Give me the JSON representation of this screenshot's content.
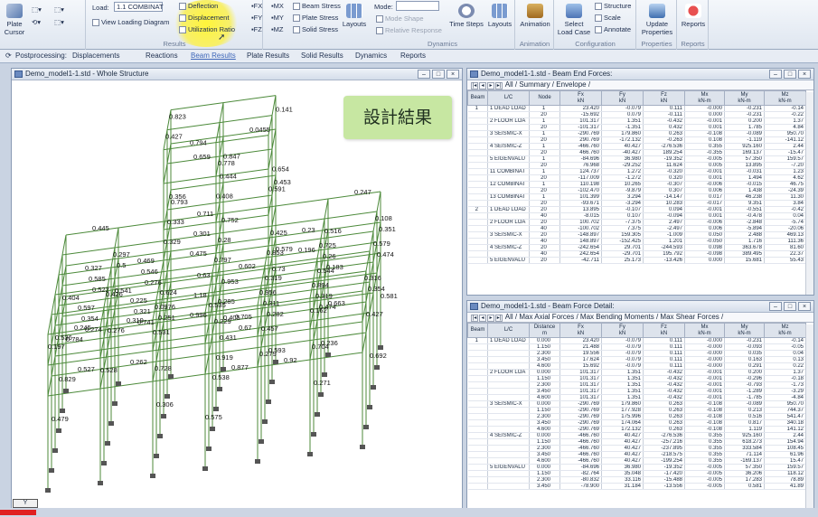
{
  "ribbon": {
    "plate_label": "Plate",
    "cursor_label": "Cursor",
    "load_label": "Load:",
    "load_value": "1.1 COMBINAT",
    "view_loading_diagram": "View Loading Diagram",
    "deflection": "Deflection",
    "displacement": "Displacement",
    "utilization_ratio": "Utilization Ratio",
    "results_group": "Results",
    "force_fx": "FX",
    "force_fy": "FY",
    "force_fz": "FZ",
    "moment_mx": "MX",
    "moment_my": "MY",
    "moment_mz": "MZ",
    "beam_stress": "Beam Stress",
    "plate_stress": "Plate Stress",
    "solid_stress": "Solid Stress",
    "layouts1": "Layouts",
    "mode_label": "Mode:",
    "mode_shape": "Mode Shape",
    "relative_response": "Relative Response",
    "time_steps": "Time Steps",
    "layouts2": "Layouts",
    "dynamics_group": "Dynamics",
    "animation": "Animation",
    "animation_group": "Animation",
    "select_load_case": "Select Load Case",
    "structure": "Structure",
    "scale": "Scale",
    "annotate": "Annotate",
    "configuration_group": "Configuration",
    "update_properties": "Update Properties",
    "properties_group": "Properties",
    "reports": "Reports",
    "reports_group": "Reports"
  },
  "tabs": [
    "Postprocessing:",
    "Displacements",
    "Reactions",
    "Beam Results",
    "Plate Results",
    "Solid Results",
    "Dynamics",
    "Reports"
  ],
  "model_window": {
    "title": "Demo_model1-1.std - Whole Structure",
    "annotation": "設計結果",
    "ratios": [
      "0.784",
      "0.522",
      "0.445",
      "0.404",
      "0.585",
      "0.829",
      "0.274",
      "0.327",
      "0.536",
      "0.354",
      "0.479",
      "0.527",
      "0.597",
      "0.197",
      "0.245",
      "0.276",
      "0.5",
      "0.541",
      "0.546",
      "0.297",
      "0.741",
      "0.469",
      "0.276",
      "0.321",
      "0.426",
      "0.262",
      "0.225",
      "0.528",
      "0.319",
      "0.793",
      "0.63",
      "0.711",
      "0.356",
      "0.823",
      "0.333",
      "1.18",
      "0.301",
      "0.659",
      "0.427",
      "0.329",
      "0.996",
      "0.475",
      "0.794",
      "0.624",
      "0.251",
      "0.306",
      "0.728",
      "0.0976",
      "0.531",
      "0.405",
      "0.847",
      "0.953",
      "0.752",
      "0.0455",
      "0.431",
      "0.444",
      "0.285",
      "0.28",
      "0.778",
      "0.919",
      "0.408",
      "0.229",
      "0.797",
      "0.538",
      "0.67",
      "0.602",
      "0.535",
      "0.705",
      "0.575",
      "0.877",
      "0.579",
      "0.141",
      "0.23",
      "0.453",
      "0.73",
      "0.654",
      "0.196",
      "0.425",
      "0.593",
      "0.591",
      "0.282",
      "0.853",
      "0.319",
      "0.311",
      "0.457",
      "0.279",
      "0.956",
      "0.92",
      "0.663",
      "0.183",
      "0.247",
      "0.516",
      "0.26",
      "0.236",
      "0.474",
      "0.725",
      "0.544",
      "0.319",
      "0.271",
      "0.704",
      "0.894",
      "0.162",
      "0.581",
      "0.351",
      "0.474",
      "0.108",
      "0.579",
      "0.692",
      "0.354",
      "0.427",
      "0.316"
    ]
  },
  "end_forces": {
    "title": "Demo_model1-1.std - Beam End Forces:",
    "sheet_tabs": [
      "All",
      "Summary",
      "Envelope"
    ],
    "headers": [
      "Beam",
      "L/C",
      "Node",
      "Fx\nkN",
      "Fy\nkN",
      "Fz\nkN",
      "Mx\nkN-m",
      "My\nkN-m",
      "Mz\nkN-m"
    ],
    "rows": [
      [
        "1",
        "1 DEAD LOAD",
        "1",
        "23.420",
        "-0.079",
        "0.111",
        "-0.000",
        "-0.231",
        "-0.14"
      ],
      [
        "",
        "",
        "20",
        "-15.692",
        "0.079",
        "-0.111",
        "0.000",
        "-0.231",
        "-0.22"
      ],
      [
        "",
        "2 FLOOR LOA",
        "1",
        "101.317",
        "1.351",
        "-0.432",
        "-0.001",
        "0.200",
        "1.37"
      ],
      [
        "",
        "",
        "20",
        "-101.317",
        "-1.351",
        "0.432",
        "0.001",
        "1.785",
        "4.84"
      ],
      [
        "",
        "3 SEISMIC-X",
        "1",
        "-290.769",
        "179.860",
        "0.263",
        "-0.108",
        "-0.089",
        "950.70"
      ],
      [
        "",
        "",
        "20",
        "290.769",
        "-172.132",
        "-0.263",
        "0.108",
        "-1.119",
        "-141.12"
      ],
      [
        "",
        "4 SEISMIC-Z",
        "1",
        "-466.760",
        "40.427",
        "-276.536",
        "0.355",
        "925.160",
        "2.44"
      ],
      [
        "",
        "",
        "20",
        "466.760",
        "-40.427",
        "189.254",
        "-0.355",
        "169.137",
        "-15.47"
      ],
      [
        "",
        "5 EIGENVALU",
        "1",
        "-84.696",
        "36.980",
        "-19.352",
        "-0.005",
        "57.350",
        "159.57"
      ],
      [
        "",
        "",
        "20",
        "76.968",
        "-29.252",
        "11.624",
        "0.005",
        "13.895",
        "-7.20"
      ],
      [
        "",
        "11 COMBINAT",
        "1",
        "124.737",
        "1.272",
        "-0.320",
        "-0.001",
        "-0.031",
        "1.23"
      ],
      [
        "",
        "",
        "20",
        "-117.009",
        "-1.272",
        "0.320",
        "0.001",
        "1.494",
        "4.62"
      ],
      [
        "",
        "12 COMBINAT",
        "1",
        "110.198",
        "10.265",
        "-0.307",
        "-0.006",
        "-0.015",
        "46.75"
      ],
      [
        "",
        "",
        "20",
        "-102.470",
        "-9.879",
        "0.307",
        "0.006",
        "1.438",
        "-24.39"
      ],
      [
        "",
        "13 COMBINAT",
        "1",
        "101.399",
        "3.294",
        "-14.147",
        "0.017",
        "46.238",
        "11.30"
      ],
      [
        "",
        "",
        "20",
        "-93.671",
        "-3.294",
        "10.283",
        "-0.017",
        "9.351",
        "3.84"
      ],
      [
        "2",
        "1 DEAD LOAD",
        "20",
        "13.895",
        "-0.107",
        "0.094",
        "-0.001",
        "-0.551",
        "-0.42"
      ],
      [
        "",
        "",
        "40",
        "-8.015",
        "0.107",
        "-0.094",
        "0.001",
        "-0.478",
        "0.04"
      ],
      [
        "",
        "2 FLOOR LOA",
        "20",
        "100.702",
        "-7.375",
        "2.497",
        "-0.006",
        "-2.848",
        "-5.74"
      ],
      [
        "",
        "",
        "40",
        "-100.702",
        "7.375",
        "-2.497",
        "0.006",
        "-5.894",
        "-20.06"
      ],
      [
        "",
        "3 SEISMIC-X",
        "20",
        "-148.897",
        "159.305",
        "-1.009",
        "0.050",
        "2.488",
        "469.13"
      ],
      [
        "",
        "",
        "40",
        "148.897",
        "-152.425",
        "1.201",
        "-0.050",
        "1.716",
        "111.36"
      ],
      [
        "",
        "4 SEISMIC-Z",
        "20",
        "-242.654",
        "29.701",
        "-244.593",
        "0.098",
        "363.678",
        "81.60"
      ],
      [
        "",
        "",
        "40",
        "242.654",
        "-29.701",
        "195.792",
        "-0.098",
        "389.495",
        "22.37"
      ],
      [
        "",
        "5 EIGENVALU",
        "20",
        "-42.711",
        "25.173",
        "-13.426",
        "0.000",
        "15.681",
        "55.43"
      ]
    ]
  },
  "force_detail": {
    "title": "Demo_model1-1.std - Beam Force Detail:",
    "sheet_tabs": [
      "All",
      "Max Axial Forces",
      "Max Bending Moments",
      "Max Shear Forces"
    ],
    "headers": [
      "Beam",
      "L/C",
      "Distance\nm",
      "Fx\nkN",
      "Fy\nkN",
      "Fz\nkN",
      "Mx\nkN-m",
      "My\nkN-m",
      "Mz\nkN-m"
    ],
    "rows": [
      [
        "1",
        "1 DEAD LOAD",
        "0.000",
        "23.420",
        "-0.079",
        "0.111",
        "-0.000",
        "-0.231",
        "-0.14"
      ],
      [
        "",
        "",
        "1.150",
        "21.488",
        "-0.079",
        "0.111",
        "-0.000",
        "-0.093",
        "-0.05"
      ],
      [
        "",
        "",
        "2.300",
        "19.556",
        "-0.079",
        "0.111",
        "-0.000",
        "0.035",
        "0.04"
      ],
      [
        "",
        "",
        "3.450",
        "17.624",
        "-0.079",
        "0.111",
        "-0.000",
        "0.163",
        "0.13"
      ],
      [
        "",
        "",
        "4.600",
        "15.692",
        "-0.079",
        "0.111",
        "-0.000",
        "0.291",
        "0.22"
      ],
      [
        "",
        "2 FLOOR LOA",
        "0.000",
        "101.317",
        "1.351",
        "-0.432",
        "-0.001",
        "0.200",
        "1.37"
      ],
      [
        "",
        "",
        "1.150",
        "101.317",
        "1.351",
        "-0.432",
        "-0.001",
        "-0.296",
        "-0.18"
      ],
      [
        "",
        "",
        "2.300",
        "101.317",
        "1.351",
        "-0.432",
        "-0.001",
        "-0.793",
        "-1.73"
      ],
      [
        "",
        "",
        "3.450",
        "101.317",
        "1.351",
        "-0.432",
        "-0.001",
        "-1.289",
        "-3.29"
      ],
      [
        "",
        "",
        "4.600",
        "101.317",
        "1.351",
        "-0.432",
        "-0.001",
        "-1.785",
        "-4.84"
      ],
      [
        "",
        "3 SEISMIC-X",
        "0.000",
        "-290.769",
        "179.860",
        "0.263",
        "-0.108",
        "-0.089",
        "950.70"
      ],
      [
        "",
        "",
        "1.150",
        "-290.769",
        "177.928",
        "0.263",
        "-0.108",
        "0.213",
        "744.37"
      ],
      [
        "",
        "",
        "2.300",
        "-290.769",
        "175.996",
        "0.263",
        "-0.108",
        "0.516",
        "541.47"
      ],
      [
        "",
        "",
        "3.450",
        "-290.769",
        "174.064",
        "0.263",
        "-0.108",
        "0.817",
        "340.18"
      ],
      [
        "",
        "",
        "4.600",
        "-290.769",
        "172.132",
        "0.263",
        "-0.108",
        "1.119",
        "141.12"
      ],
      [
        "",
        "4 SEISMIC-Z",
        "0.000",
        "-466.760",
        "40.427",
        "-276.536",
        "0.355",
        "925.160",
        "2.44"
      ],
      [
        "",
        "",
        "1.150",
        "-466.760",
        "40.427",
        "-257.216",
        "0.355",
        "618.273",
        "154.94"
      ],
      [
        "",
        "",
        "2.300",
        "-466.760",
        "40.427",
        "-237.895",
        "0.355",
        "333.584",
        "108.45"
      ],
      [
        "",
        "",
        "3.450",
        "-466.760",
        "40.427",
        "-218.575",
        "0.355",
        "71.114",
        "61.96"
      ],
      [
        "",
        "",
        "4.600",
        "-466.760",
        "40.427",
        "-199.254",
        "0.355",
        "-169.137",
        "15.47"
      ],
      [
        "",
        "5 EIGENVALU",
        "0.000",
        "-84.696",
        "36.980",
        "-19.352",
        "-0.005",
        "57.350",
        "159.57"
      ],
      [
        "",
        "",
        "1.150",
        "-82.764",
        "35.048",
        "-17.420",
        "-0.005",
        "36.206",
        "118.12"
      ],
      [
        "",
        "",
        "2.300",
        "-80.832",
        "33.116",
        "-15.488",
        "-0.005",
        "17.283",
        "78.89"
      ],
      [
        "",
        "",
        "3.450",
        "-78.900",
        "31.184",
        "-13.556",
        "-0.005",
        "0.581",
        "41.89"
      ]
    ]
  }
}
